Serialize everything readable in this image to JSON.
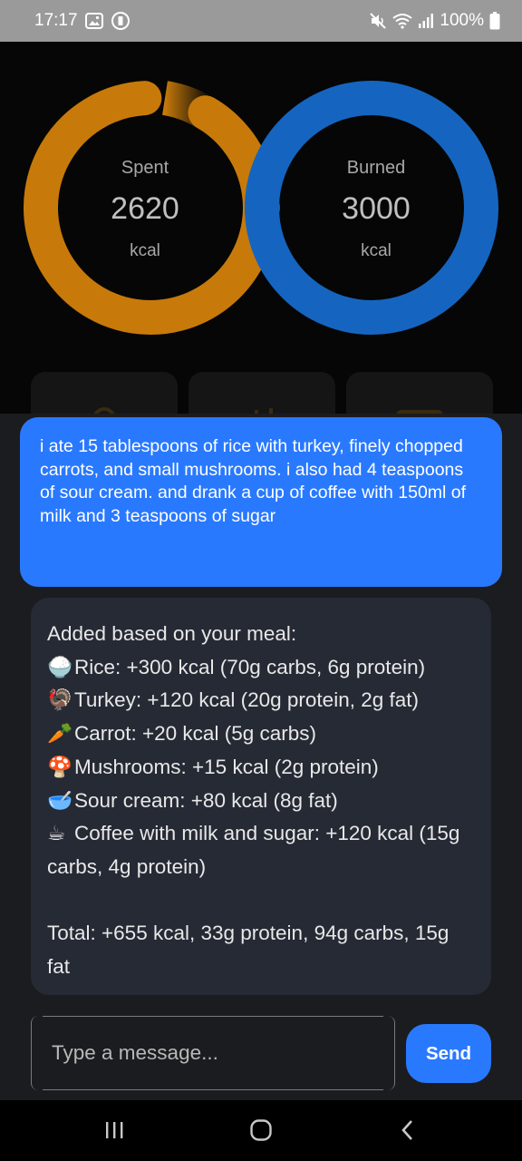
{
  "status_bar": {
    "time": "17:17",
    "battery": "100%"
  },
  "dashboard": {
    "spent": {
      "caption": "Spent",
      "value": "2620",
      "unit": "kcal",
      "color": "#c77a0a"
    },
    "burned": {
      "caption": "Burned",
      "value": "3000",
      "unit": "kcal",
      "color": "#1565c0"
    }
  },
  "chat": {
    "user_message": "i ate 15 tablespoons of rice with turkey, finely chopped carrots, and small mushrooms. i also had 4 teaspoons of sour cream. and drank a cup of coffee with 150ml of milk and 3 teaspoons of sugar",
    "bot_reply": {
      "intro": "Added based on your meal:",
      "items": [
        {
          "icon": "🍚",
          "icon_name": "rice-icon",
          "text": "Rice: +300 kcal (70g carbs, 6g protein)"
        },
        {
          "icon": "🦃",
          "icon_name": "turkey-icon",
          "text": "Turkey: +120 kcal (20g protein, 2g fat)"
        },
        {
          "icon": "🥕",
          "icon_name": "carrot-icon",
          "text": "Carrot: +20 kcal (5g carbs)"
        },
        {
          "icon": "🍄",
          "icon_name": "mushroom-icon",
          "text": "Mushrooms: +15 kcal (2g protein)"
        },
        {
          "icon": "🥣",
          "icon_name": "bowl-icon",
          "text": "Sour cream: +80 kcal (8g fat)"
        },
        {
          "icon": "☕",
          "icon_name": "coffee-icon",
          "text": "Coffee with milk and sugar: +120 kcal (15g carbs, 4g protein)"
        }
      ],
      "total": "Total: +655 kcal, 33g protein, 94g carbs, 15g fat"
    }
  },
  "composer": {
    "placeholder": "Type a message...",
    "send_label": "Send"
  },
  "colors": {
    "accent": "#2979ff",
    "sheet": "#1b1c1f",
    "bot_bubble": "#252a35"
  }
}
